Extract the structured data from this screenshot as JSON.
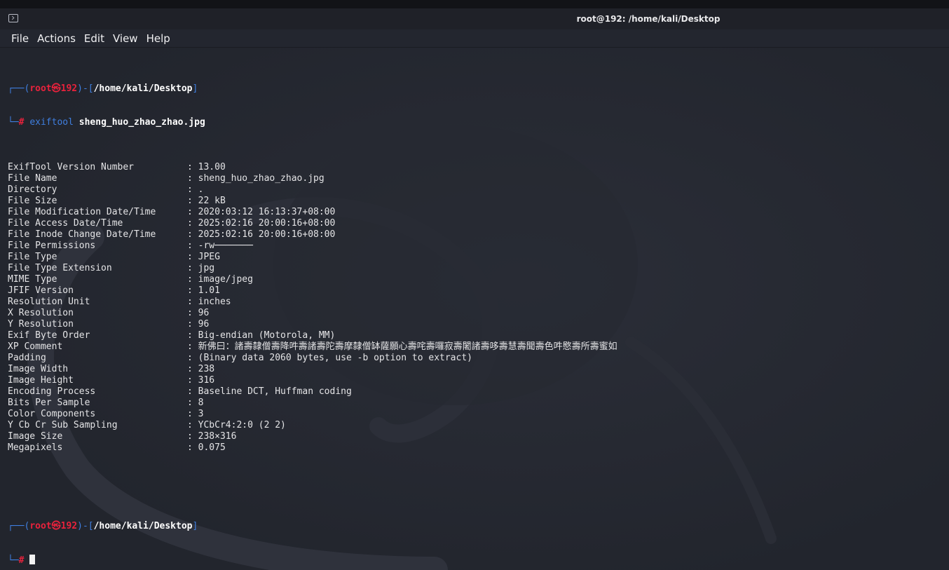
{
  "window": {
    "title": "root@192: /home/kali/Desktop"
  },
  "menu": [
    "File",
    "Actions",
    "Edit",
    "View",
    "Help"
  ],
  "prompt": {
    "open_paren": "┌──(",
    "user": "root",
    "at": "㉿",
    "host": "192",
    "mid": ")-[",
    "path": "/home/kali/Desktop",
    "close": "]",
    "corner": "└─",
    "hash": "#"
  },
  "command": {
    "name": "exiftool",
    "arg": "sheng_huo_zhao_zhao.jpg"
  },
  "output": [
    {
      "key": "ExifTool Version Number",
      "value": "13.00"
    },
    {
      "key": "File Name",
      "value": "sheng_huo_zhao_zhao.jpg"
    },
    {
      "key": "Directory",
      "value": "."
    },
    {
      "key": "File Size",
      "value": "22 kB"
    },
    {
      "key": "File Modification Date/Time",
      "value": "2020:03:12 16:13:37+08:00"
    },
    {
      "key": "File Access Date/Time",
      "value": "2025:02:16 20:00:16+08:00"
    },
    {
      "key": "File Inode Change Date/Time",
      "value": "2025:02:16 20:00:16+08:00"
    },
    {
      "key": "File Permissions",
      "value": "-rw───────"
    },
    {
      "key": "File Type",
      "value": "JPEG"
    },
    {
      "key": "File Type Extension",
      "value": "jpg"
    },
    {
      "key": "MIME Type",
      "value": "image/jpeg"
    },
    {
      "key": "JFIF Version",
      "value": "1.01"
    },
    {
      "key": "Resolution Unit",
      "value": "inches"
    },
    {
      "key": "X Resolution",
      "value": "96"
    },
    {
      "key": "Y Resolution",
      "value": "96"
    },
    {
      "key": "Exif Byte Order",
      "value": "Big-endian (Motorola, MM)"
    },
    {
      "key": "XP Comment",
      "value": "新佛曰：諸壽隸僧壽降吽壽諸壽陀壽摩隸僧缽薩願心壽咤壽囉寂壽闍諸壽哆壽慧壽聞壽色吽愍壽所壽蜜如"
    },
    {
      "key": "Padding",
      "value": "(Binary data 2060 bytes, use -b option to extract)"
    },
    {
      "key": "Image Width",
      "value": "238"
    },
    {
      "key": "Image Height",
      "value": "316"
    },
    {
      "key": "Encoding Process",
      "value": "Baseline DCT, Huffman coding"
    },
    {
      "key": "Bits Per Sample",
      "value": "8"
    },
    {
      "key": "Color Components",
      "value": "3"
    },
    {
      "key": "Y Cb Cr Sub Sampling",
      "value": "YCbCr4:2:0 (2 2)"
    },
    {
      "key": "Image Size",
      "value": "238×316"
    },
    {
      "key": "Megapixels",
      "value": "0.075"
    }
  ],
  "separator": ":",
  "colors": {
    "background": "#23262f",
    "prompt_blue": "#3f7fe0",
    "prompt_red": "#e8223c",
    "text": "#e4e4e6"
  }
}
